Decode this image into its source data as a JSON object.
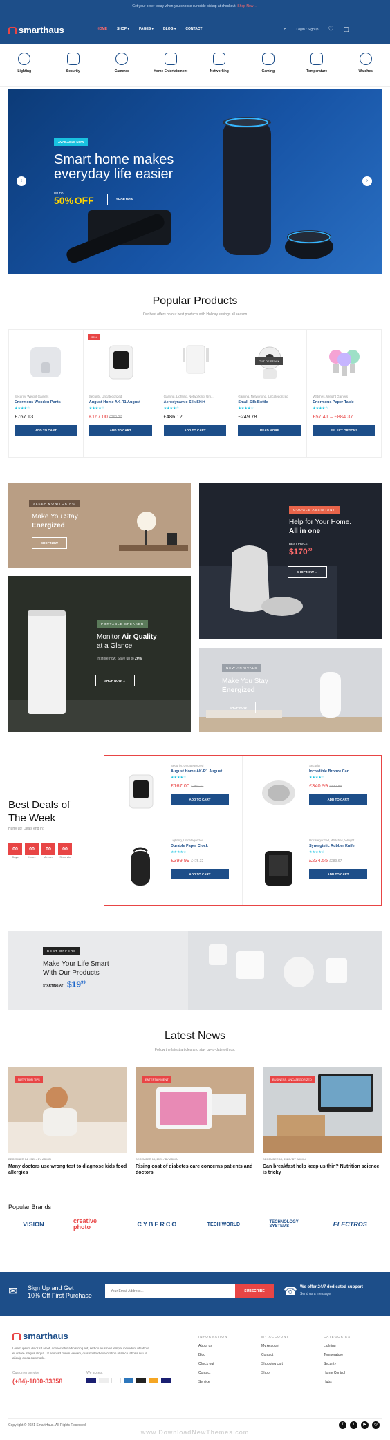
{
  "topbar": {
    "text": "Get your order today when you choose curbside pickup at checkout.",
    "link": "Shop Now →"
  },
  "header": {
    "logo": "smarthaus",
    "menu": [
      "HOME",
      "SHOP",
      "PAGES",
      "BLOG",
      "CONTACT"
    ],
    "login": "Login / Signup"
  },
  "categories": [
    "Lighting",
    "Security",
    "Cameras",
    "Home Entertainment",
    "Networking",
    "Gaming",
    "Temperature",
    "Watches"
  ],
  "hero": {
    "badge": "AVAILABLE NOW",
    "title1": "Smart home makes",
    "title2": "everyday life easier",
    "upto": "UP TO",
    "percent": "50%",
    "off": "OFF",
    "button": "SHOP NOW"
  },
  "popular": {
    "title": "Popular Products",
    "subtitle": "Our best offers on our best products with Holiday savings all season",
    "products": [
      {
        "cat": "Security, Weight Gainers",
        "name": "Enormous Wooden Pants",
        "price": "£767.13",
        "old": "",
        "button": "ADD TO CART",
        "badge": ""
      },
      {
        "cat": "Security, Uncategorized",
        "name": "August Home AK-R1 August",
        "price": "£167.00",
        "old": "£260.27",
        "button": "ADD TO CART",
        "badge": "-36%"
      },
      {
        "cat": "Gaming, Lighting, Networking, Uni...",
        "name": "Aerodynamic Silk Shirt",
        "price": "£486.12",
        "old": "",
        "button": "ADD TO CART",
        "badge": ""
      },
      {
        "cat": "Gaming, Networking, Uncategorized",
        "name": "Small Silk Bottle",
        "price": "£249.78",
        "old": "",
        "button": "READ MORE",
        "badge": "OUT OF STOCK"
      },
      {
        "cat": "Watches, Weight Gainers",
        "name": "Enormous Paper Table",
        "price": "£57.41 – £884.37",
        "old": "",
        "button": "SELECT OPTIONS",
        "badge": ""
      }
    ]
  },
  "banners": {
    "b1": {
      "tag": "SLEEP MONITORING",
      "l1": "Make You Stay",
      "l2": "Energized",
      "button": "SHOP NOW"
    },
    "b2": {
      "tag": "GOOGLE ASSISTANT",
      "l1": "Help for Your Home.",
      "l2": "All in one",
      "best": "BEST PRICE",
      "price": "$170",
      "cents": "99",
      "button": "SHOP NOW"
    },
    "b3": {
      "tag": "PORTABLE SPEAKER",
      "l1": "Monitor",
      "l1b": "Air Quality",
      "l2": "at a Glance",
      "sub": "In store now. Save up to",
      "save": "20%",
      "button": "SHOP NOW"
    },
    "b4": {
      "tag": "NEW ARRIVALS",
      "l1": "Make You Stay",
      "l2": "Energized",
      "button": "SHOP NOW"
    }
  },
  "deals": {
    "title1": "Best Deals of",
    "title2": "The Week",
    "sub": "Hurry up! Deals end in:",
    "countdown": [
      {
        "v": "00",
        "l": "Days"
      },
      {
        "v": "00",
        "l": "Hours"
      },
      {
        "v": "00",
        "l": "Minutes"
      },
      {
        "v": "00",
        "l": "Seconds"
      }
    ],
    "items": [
      {
        "cat": "Security, Uncategorized",
        "name": "August Home AK-R1 August",
        "price": "£167.00",
        "old": "£260.27",
        "button": "ADD TO CART"
      },
      {
        "cat": "Security",
        "name": "Incredible Bronze Car",
        "price": "£340.99",
        "old": "£437.84",
        "button": "ADD TO CART"
      },
      {
        "cat": "Lighting, Uncategorized",
        "name": "Durable Paper Clock",
        "price": "£399.99",
        "old": "£475.32",
        "button": "ADD TO CART"
      },
      {
        "cat": "Uncategorized, Watches, Weight...",
        "name": "Synergistic Rubber Knife",
        "price": "£234.55",
        "old": "£289.67",
        "button": "ADD TO CART"
      }
    ]
  },
  "offer": {
    "tag": "BEST OFFERS",
    "l1": "Make Your Life Smart",
    "l2": "With Our Products",
    "starting": "STARTING AT",
    "price": "$19",
    "cents": "99"
  },
  "news": {
    "title": "Latest News",
    "subtitle": "Follow the latest articles and stay up-to-date with us.",
    "items": [
      {
        "tag": "NUTRITION TIPS",
        "meta": "DECEMBER 14, 2020 / BY ADMIN",
        "title": "Many doctors use wrong test to diagnose kids food allergies"
      },
      {
        "tag": "ENTERTAINMENT",
        "meta": "DECEMBER 10, 2020 / BY ADMIN",
        "title": "Rising cost of diabetes care concerns patients and doctors"
      },
      {
        "tag": "BUSINESS, UNCATEGORIZED",
        "meta": "DECEMBER 10, 2020 / BY ADMIN",
        "title": "Can breakfast help keep us thin? Nutrition science is tricky"
      }
    ]
  },
  "brands": {
    "title": "Popular Brands",
    "items": [
      "VISION",
      "creative photo",
      "CYBERCO",
      "TECH WORLD",
      "TECHNOLOGY SYSTEMS",
      "ELECTROS"
    ]
  },
  "newsletter": {
    "l1": "Sign Up and Get",
    "l2": "10% Off First Purchase",
    "placeholder": "Your Email Address...",
    "button": "SUBSCRIBE",
    "support": "We offer 24/7 dedicated support",
    "send": "Send us a message"
  },
  "footer": {
    "logo": "smarthaus",
    "desc": "Lorem ipsum dolor sit amet, consectetur adipisicing elit, sed do eiusmod tempor incididunt ut labore et dolore magna aliqua. Ut enim ad minim veniam, quis nostrud exercitation ullamco laboris nisi ut aliquip ex ea commodo.",
    "service": "Customer service",
    "phone": "(+84)-1800-33358",
    "accept": "We accept",
    "cols": [
      {
        "h": "INFORMATION",
        "links": [
          "About us",
          "Blog",
          "Check out",
          "Contact",
          "Service"
        ]
      },
      {
        "h": "MY ACCOUNT",
        "links": [
          "My Account",
          "Contact",
          "Shopping cart",
          "Shop"
        ]
      },
      {
        "h": "CATEGORIES",
        "links": [
          "Lighting",
          "Temperature",
          "Security",
          "Home Control",
          "Hubs"
        ]
      }
    ],
    "copyright": "Copyright © 2021 SmartHaus. All Rights Reserved.",
    "watermark": "www.DownloadNewThemes.com"
  },
  "colors": {
    "primary": "#1d4e89",
    "accent": "#e84545",
    "teal": "#19c2e0"
  }
}
